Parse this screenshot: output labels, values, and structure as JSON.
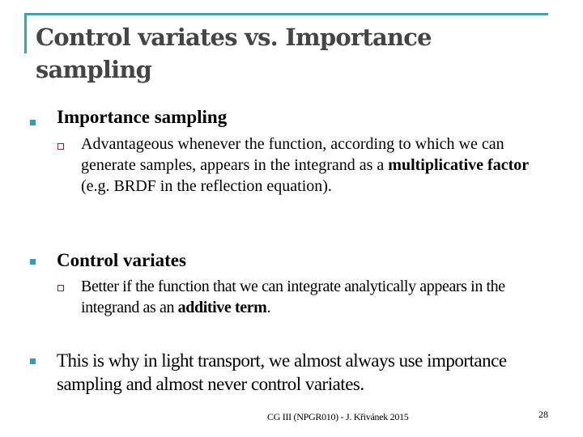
{
  "slide": {
    "title": "Control variates vs. Importance sampling",
    "accent_color": "#4a9fae",
    "bullets": [
      {
        "text": "Importance sampling",
        "sub": {
          "pre": "Advantageous whenever the function, according to which we can generate samples, appears in the integrand as a ",
          "bold": "multiplicative factor",
          "post": " (e.g. BRDF in the reflection equation)."
        }
      },
      {
        "text": "Control variates",
        "sub": {
          "pre": "Better if the function that we can integrate analytically appears in the integrand as an ",
          "bold": "additive term",
          "post": "."
        }
      },
      {
        "text": "This is why in light transport, we almost always use importance sampling and almost never control variates."
      }
    ],
    "footer": "CG III (NPGR010) - J. Křivánek 2015",
    "page_number": "28"
  }
}
